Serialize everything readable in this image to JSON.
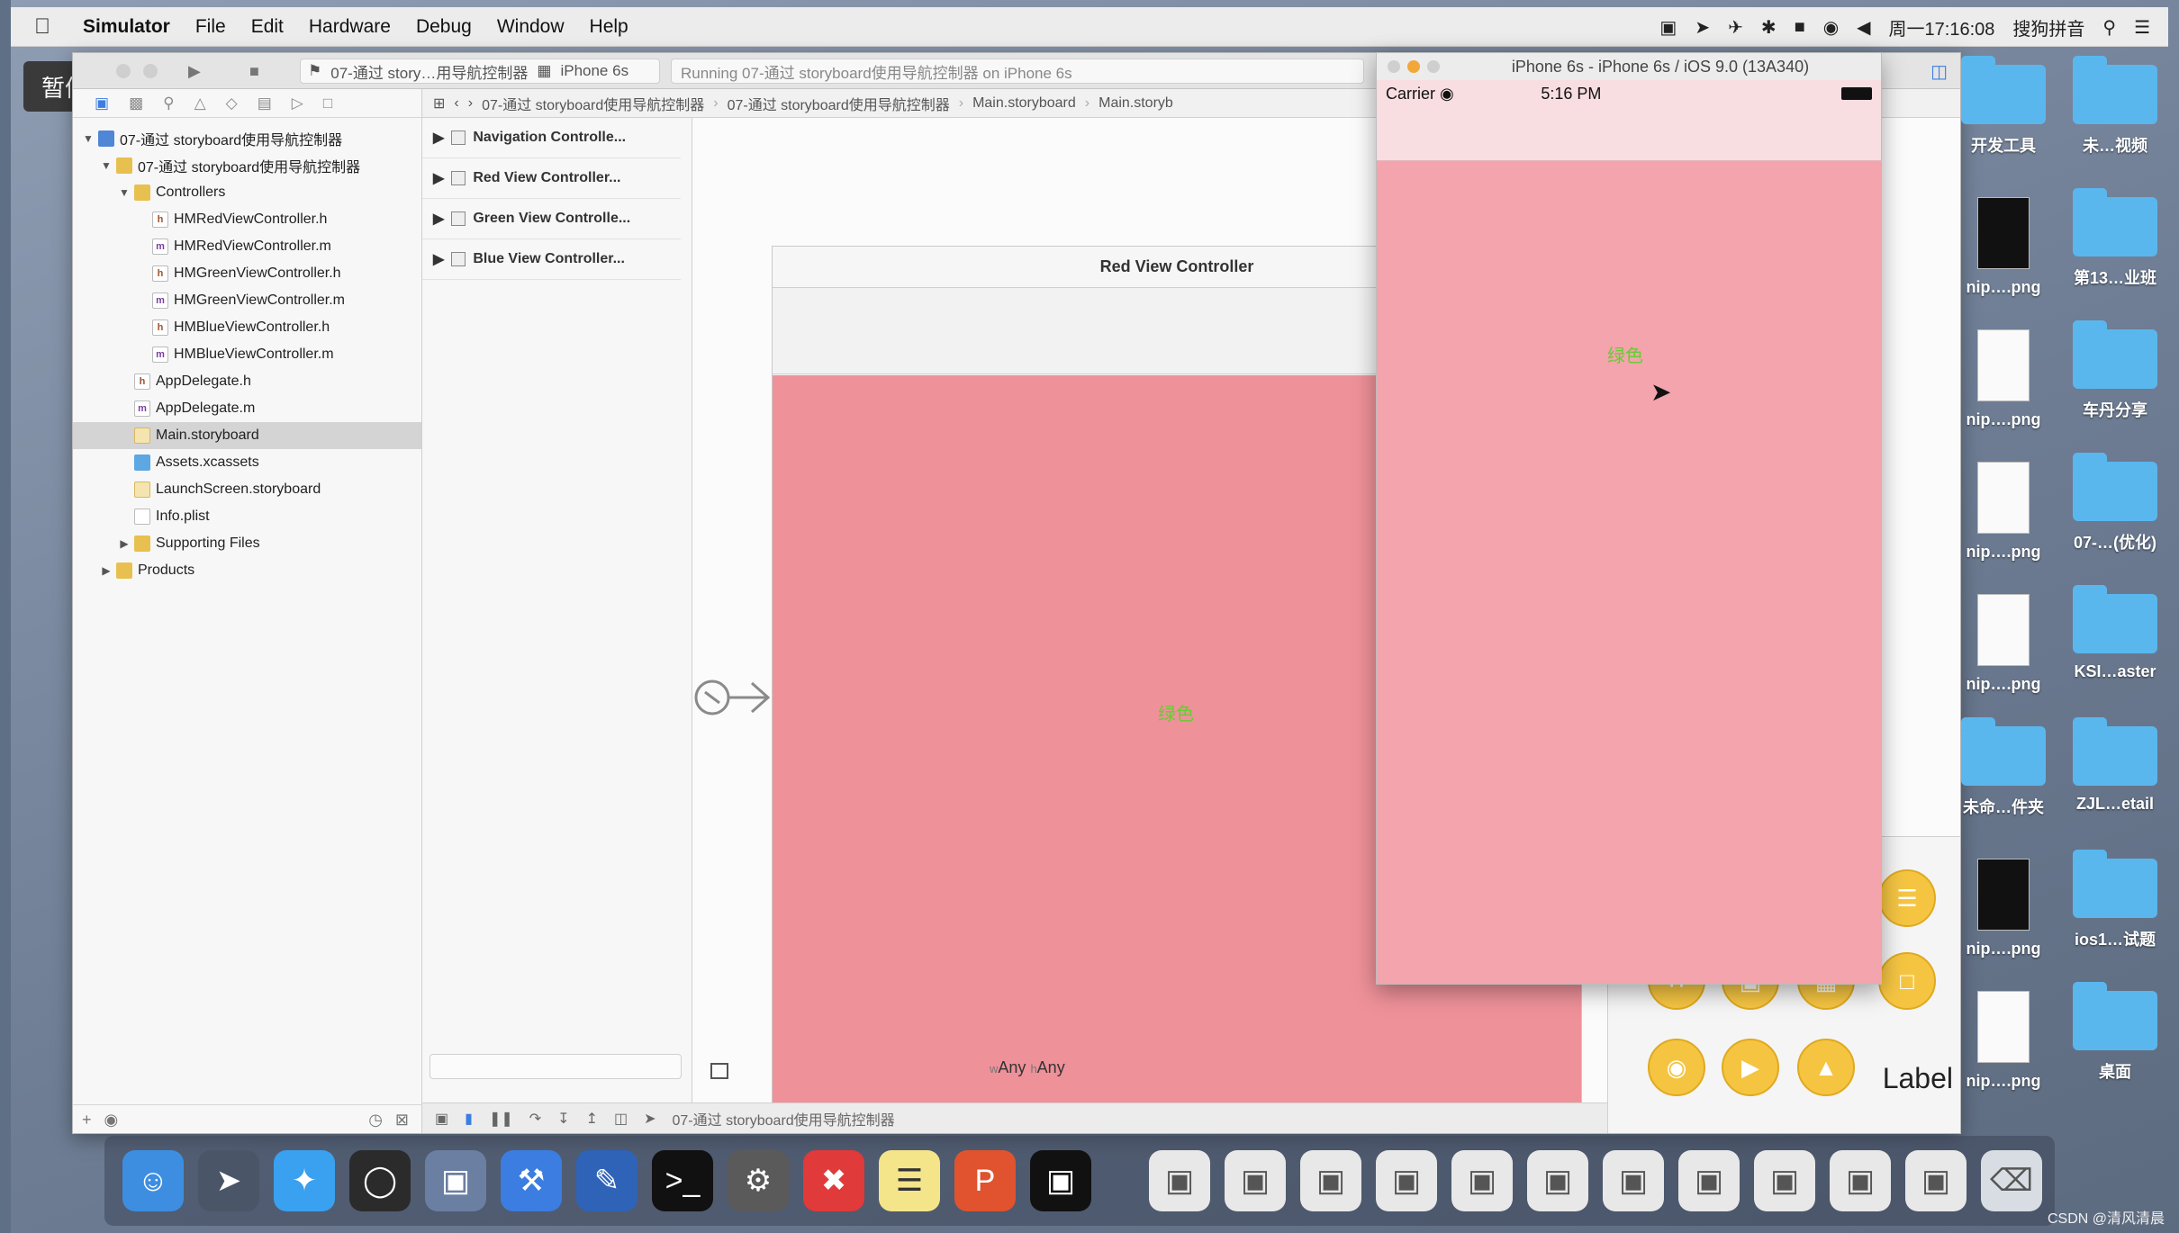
{
  "menubar": {
    "app": "Simulator",
    "items": [
      "File",
      "Edit",
      "Hardware",
      "Debug",
      "Window",
      "Help"
    ],
    "clock": "周一17:16:08",
    "ime": "搜狗拼音"
  },
  "pause_badge": "暂停",
  "xcode": {
    "scheme": "07-通过 story…用导航控制器",
    "device": "iPhone 6s",
    "activity": "Running 07-通过 storyboard使用导航控制器 on iPhone 6s",
    "breadcrumbs": [
      "07-通过 storyboard使用导航控制器",
      "07-通过 storyboard使用导航控制器",
      "Main.storyboard",
      "Main.storyb"
    ],
    "tree": [
      {
        "label": "07-通过 storyboard使用导航控制器",
        "kind": "project",
        "indent": 0,
        "open": true
      },
      {
        "label": "07-通过 storyboard使用导航控制器",
        "kind": "folder",
        "indent": 1,
        "open": true
      },
      {
        "label": "Controllers",
        "kind": "folder",
        "indent": 2,
        "open": true
      },
      {
        "label": "HMRedViewController.h",
        "kind": "h",
        "indent": 3
      },
      {
        "label": "HMRedViewController.m",
        "kind": "m",
        "indent": 3
      },
      {
        "label": "HMGreenViewController.h",
        "kind": "h",
        "indent": 3
      },
      {
        "label": "HMGreenViewController.m",
        "kind": "m",
        "indent": 3
      },
      {
        "label": "HMBlueViewController.h",
        "kind": "h",
        "indent": 3
      },
      {
        "label": "HMBlueViewController.m",
        "kind": "m",
        "indent": 3
      },
      {
        "label": "AppDelegate.h",
        "kind": "h",
        "indent": 2
      },
      {
        "label": "AppDelegate.m",
        "kind": "m",
        "indent": 2
      },
      {
        "label": "Main.storyboard",
        "kind": "sb",
        "indent": 2,
        "selected": true
      },
      {
        "label": "Assets.xcassets",
        "kind": "assets",
        "indent": 2
      },
      {
        "label": "LaunchScreen.storyboard",
        "kind": "sb",
        "indent": 2
      },
      {
        "label": "Info.plist",
        "kind": "plist",
        "indent": 2
      },
      {
        "label": "Supporting Files",
        "kind": "folder",
        "indent": 2,
        "closed": true
      },
      {
        "label": "Products",
        "kind": "folder",
        "indent": 1,
        "closed": true
      }
    ],
    "outline": [
      "Navigation Controlle...",
      "Red View Controller...",
      "Green View Controlle...",
      "Blue View Controller..."
    ],
    "scene_title": "Red View Controller",
    "scene_label": "绿色",
    "size_class": {
      "w_prefix": "w",
      "w": "Any",
      "h_prefix": "h",
      "h": "Any"
    },
    "debug_target": "07-通过 storyboard使用导航控制器",
    "library_label": "Label"
  },
  "simulator": {
    "title": "iPhone 6s - iPhone 6s / iOS 9.0 (13A340)",
    "carrier": "Carrier",
    "time": "5:16 PM",
    "label": "绿色",
    "background": "#f3a4ad"
  },
  "desktop_icons": [
    {
      "label": "开发工具",
      "type": "folder"
    },
    {
      "label": "未…视频",
      "type": "folder"
    },
    {
      "label": "nip….png",
      "type": "file-dark"
    },
    {
      "label": "第13…业班",
      "type": "folder"
    },
    {
      "label": "nip….png",
      "type": "file"
    },
    {
      "label": "车丹分享",
      "type": "folder"
    },
    {
      "label": "nip….png",
      "type": "file"
    },
    {
      "label": "07-…(优化)",
      "type": "folder"
    },
    {
      "label": "nip….png",
      "type": "file"
    },
    {
      "label": "KSI…aster",
      "type": "folder"
    },
    {
      "label": "未命…件夹",
      "type": "folder"
    },
    {
      "label": "ZJL…etail",
      "type": "folder"
    },
    {
      "label": "nip….png",
      "type": "file-dark"
    },
    {
      "label": "ios1…试题",
      "type": "folder"
    },
    {
      "label": "nip….png",
      "type": "file"
    },
    {
      "label": "桌面",
      "type": "folder"
    }
  ],
  "watermark": "CSDN @清风清晨"
}
